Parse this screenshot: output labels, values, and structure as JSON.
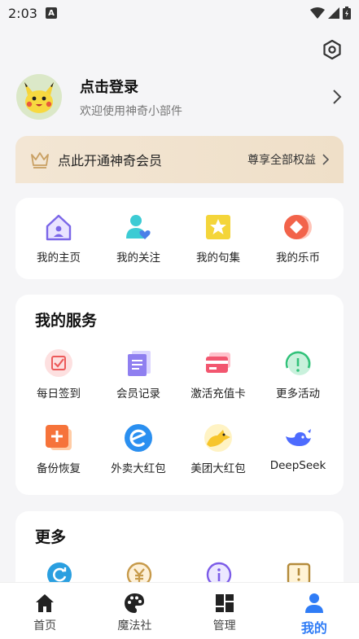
{
  "status": {
    "time": "2:03",
    "a_icon": "A"
  },
  "profile": {
    "title": "点击登录",
    "subtitle": "欢迎使用神奇小部件"
  },
  "vip": {
    "label": "点此开通神奇会员",
    "action": "尊享全部权益"
  },
  "quick": [
    {
      "label": "我的主页",
      "icon": "home-icon"
    },
    {
      "label": "我的关注",
      "icon": "follow-icon"
    },
    {
      "label": "我的句集",
      "icon": "star-icon"
    },
    {
      "label": "我的乐币",
      "icon": "coin-icon"
    }
  ],
  "services": {
    "title": "我的服务",
    "items": [
      {
        "label": "每日签到",
        "icon": "checkin-icon"
      },
      {
        "label": "会员记录",
        "icon": "record-icon"
      },
      {
        "label": "激活充值卡",
        "icon": "card-icon"
      },
      {
        "label": "更多活动",
        "icon": "activity-icon"
      },
      {
        "label": "备份恢复",
        "icon": "backup-icon"
      },
      {
        "label": "外卖大红包",
        "icon": "eleme-icon"
      },
      {
        "label": "美团大红包",
        "icon": "meituan-icon"
      },
      {
        "label": "DeepSeek",
        "icon": "deepseek-icon"
      }
    ]
  },
  "more": {
    "title": "更多"
  },
  "tabs": [
    {
      "label": "首页",
      "icon": "home-tab-icon"
    },
    {
      "label": "魔法社",
      "icon": "palette-icon"
    },
    {
      "label": "管理",
      "icon": "grid-icon"
    },
    {
      "label": "我的",
      "icon": "person-icon",
      "active": true
    }
  ],
  "colors": {
    "accent": "#2f7cf6",
    "vip_bg": "#f1e3cf"
  }
}
